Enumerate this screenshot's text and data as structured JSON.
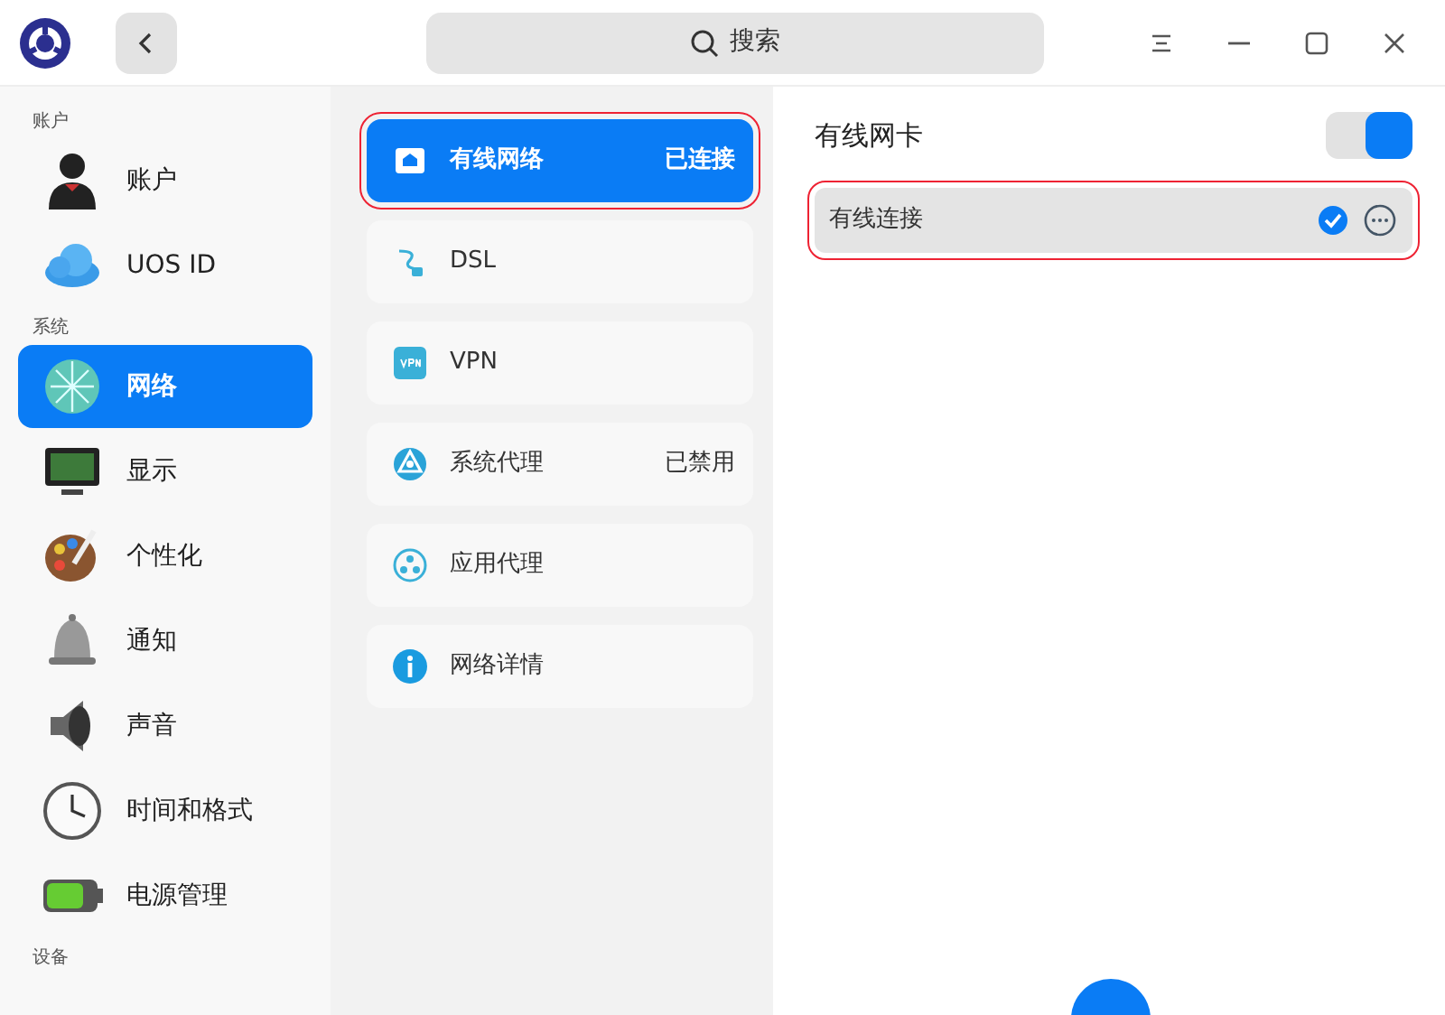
{
  "titlebar": {
    "search_placeholder": "搜索"
  },
  "sidebar": {
    "sections": [
      {
        "title": "账户",
        "items": [
          {
            "label": "账户",
            "selected": false
          },
          {
            "label": "UOS ID",
            "selected": false
          }
        ]
      },
      {
        "title": "系统",
        "items": [
          {
            "label": "网络",
            "selected": true
          },
          {
            "label": "显示",
            "selected": false
          },
          {
            "label": "个性化",
            "selected": false
          },
          {
            "label": "通知",
            "selected": false
          },
          {
            "label": "声音",
            "selected": false
          },
          {
            "label": "时间和格式",
            "selected": false
          },
          {
            "label": "电源管理",
            "selected": false
          }
        ]
      },
      {
        "title": "设备"
      }
    ]
  },
  "network_menu": [
    {
      "label": "有线网络",
      "status": "已连接",
      "selected": true,
      "highlighted": true
    },
    {
      "label": "DSL",
      "selected": false,
      "highlighted": false
    },
    {
      "label": "VPN",
      "selected": false,
      "highlighted": false
    },
    {
      "label": "系统代理",
      "status": "已禁用",
      "selected": false,
      "highlighted": false
    },
    {
      "label": "应用代理",
      "selected": false,
      "highlighted": false
    },
    {
      "label": "网络详情",
      "selected": false,
      "highlighted": false
    }
  ],
  "detail": {
    "title": "有线网卡",
    "on": true,
    "connections": [
      {
        "label": "有线连接",
        "connected": true,
        "highlighted": true
      }
    ]
  }
}
